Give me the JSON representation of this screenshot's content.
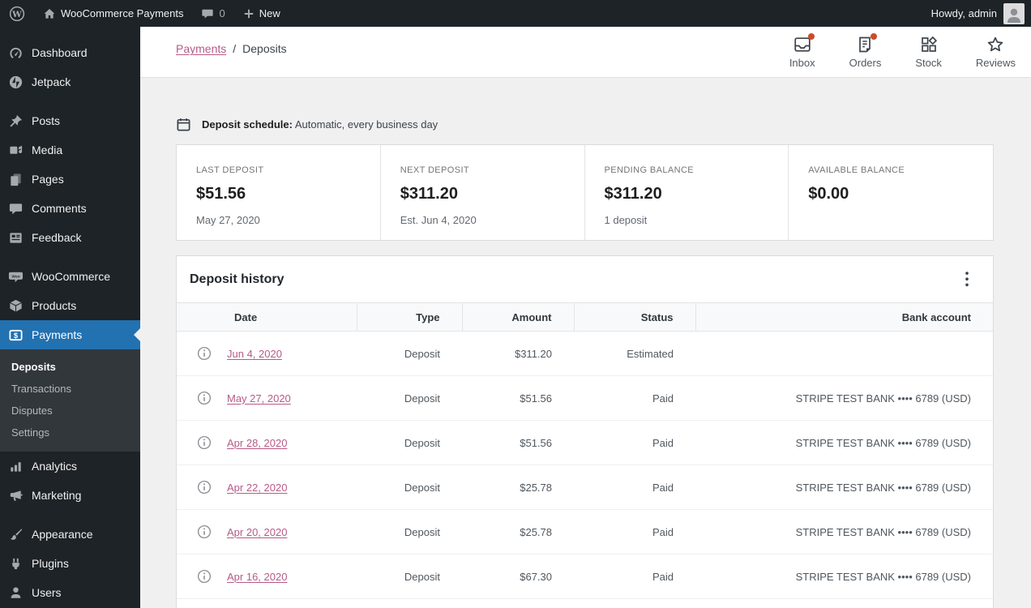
{
  "admin_bar": {
    "site_name": "WooCommerce Payments",
    "comments_count": "0",
    "new_label": "New",
    "howdy": "Howdy, admin"
  },
  "sidebar": {
    "items": [
      {
        "type": "item",
        "label": "Dashboard",
        "icon": "dashboard"
      },
      {
        "type": "item",
        "label": "Jetpack",
        "icon": "jetpack"
      },
      {
        "type": "gap"
      },
      {
        "type": "item",
        "label": "Posts",
        "icon": "posts"
      },
      {
        "type": "item",
        "label": "Media",
        "icon": "media"
      },
      {
        "type": "item",
        "label": "Pages",
        "icon": "pages"
      },
      {
        "type": "item",
        "label": "Comments",
        "icon": "comments"
      },
      {
        "type": "item",
        "label": "Feedback",
        "icon": "feedback"
      },
      {
        "type": "gap"
      },
      {
        "type": "item",
        "label": "WooCommerce",
        "icon": "woocommerce"
      },
      {
        "type": "item",
        "label": "Products",
        "icon": "products"
      },
      {
        "type": "item",
        "label": "Payments",
        "icon": "payments",
        "active": true
      },
      {
        "type": "subitem",
        "label": "Deposits",
        "current": true
      },
      {
        "type": "subitem",
        "label": "Transactions"
      },
      {
        "type": "subitem",
        "label": "Disputes"
      },
      {
        "type": "subitem",
        "label": "Settings"
      },
      {
        "type": "item",
        "label": "Analytics",
        "icon": "analytics"
      },
      {
        "type": "item",
        "label": "Marketing",
        "icon": "marketing"
      },
      {
        "type": "gap"
      },
      {
        "type": "item",
        "label": "Appearance",
        "icon": "appearance"
      },
      {
        "type": "item",
        "label": "Plugins",
        "icon": "plugins"
      },
      {
        "type": "item",
        "label": "Users",
        "icon": "users"
      }
    ]
  },
  "header": {
    "breadcrumb_link": "Payments",
    "breadcrumb_separator": "/",
    "breadcrumb_current": "Deposits",
    "activity": [
      {
        "label": "Inbox",
        "icon": "inbox",
        "badge": true
      },
      {
        "label": "Orders",
        "icon": "orders",
        "badge": true
      },
      {
        "label": "Stock",
        "icon": "stock",
        "badge": false
      },
      {
        "label": "Reviews",
        "icon": "reviews",
        "badge": false
      }
    ]
  },
  "schedule": {
    "label": "Deposit schedule:",
    "value": "Automatic, every business day"
  },
  "summary_cards": [
    {
      "label": "LAST DEPOSIT",
      "value": "$51.56",
      "sub": "May 27, 2020"
    },
    {
      "label": "NEXT DEPOSIT",
      "value": "$311.20",
      "sub": "Est. Jun 4, 2020"
    },
    {
      "label": "PENDING BALANCE",
      "value": "$311.20",
      "sub": "1 deposit"
    },
    {
      "label": "AVAILABLE BALANCE",
      "value": "$0.00",
      "sub": ""
    }
  ],
  "table": {
    "title": "Deposit history",
    "columns": [
      "Date",
      "Type",
      "Amount",
      "Status",
      "Bank account"
    ],
    "rows": [
      {
        "date": "Jun 4, 2020",
        "type": "Deposit",
        "amount": "$311.20",
        "status": "Estimated",
        "bank": ""
      },
      {
        "date": "May 27, 2020",
        "type": "Deposit",
        "amount": "$51.56",
        "status": "Paid",
        "bank": "STRIPE TEST BANK •••• 6789 (USD)"
      },
      {
        "date": "Apr 28, 2020",
        "type": "Deposit",
        "amount": "$51.56",
        "status": "Paid",
        "bank": "STRIPE TEST BANK •••• 6789 (USD)"
      },
      {
        "date": "Apr 22, 2020",
        "type": "Deposit",
        "amount": "$25.78",
        "status": "Paid",
        "bank": "STRIPE TEST BANK •••• 6789 (USD)"
      },
      {
        "date": "Apr 20, 2020",
        "type": "Deposit",
        "amount": "$25.78",
        "status": "Paid",
        "bank": "STRIPE TEST BANK •••• 6789 (USD)"
      },
      {
        "date": "Apr 16, 2020",
        "type": "Deposit",
        "amount": "$67.30",
        "status": "Paid",
        "bank": "STRIPE TEST BANK •••• 6789 (USD)"
      }
    ]
  },
  "colors": {
    "accent_link": "#b65a88",
    "active_menu": "#2271b1",
    "unread_badge": "#cd4b27",
    "admin_dark": "#1d2327"
  }
}
